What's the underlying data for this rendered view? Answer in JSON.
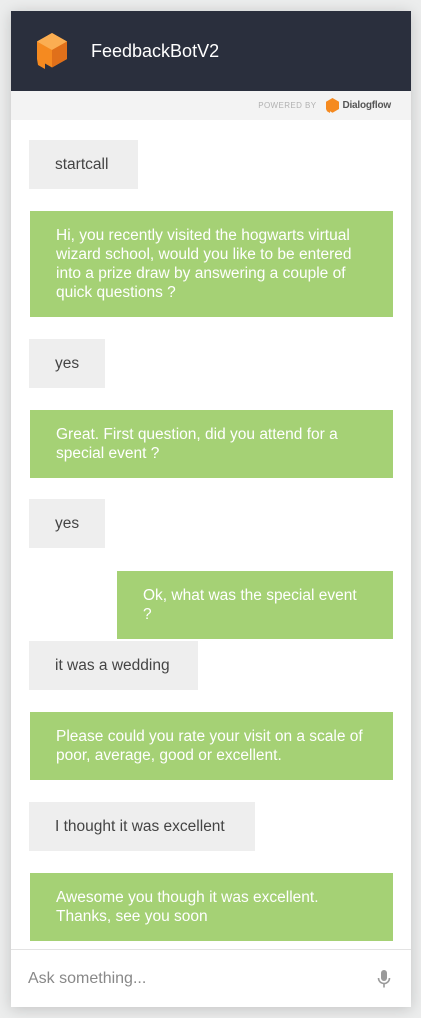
{
  "header": {
    "title": "FeedbackBotV2",
    "logo_icon": "dialogflow-bot-icon"
  },
  "powered_by": {
    "label": "POWERED BY",
    "brand": "Dialogflow"
  },
  "messages": [
    {
      "from": "user",
      "text": "startcall"
    },
    {
      "from": "bot",
      "text": "Hi, you recently visited the hogwarts virtual wizard school, would you like to be entered into a prize draw by answering a couple of quick questions ?"
    },
    {
      "from": "user",
      "text": "yes"
    },
    {
      "from": "bot",
      "text": "Great. First question, did you attend for a special event ?"
    },
    {
      "from": "user",
      "text": "yes"
    },
    {
      "from": "bot",
      "text": "Ok, what was the special event ?"
    },
    {
      "from": "user",
      "text": "it was a wedding"
    },
    {
      "from": "bot",
      "text": "Please could you rate your visit on a scale of poor, average, good or excellent."
    },
    {
      "from": "user",
      "text": "I thought it was excellent"
    },
    {
      "from": "bot",
      "text": "Awesome you though it was excellent. Thanks, see you soon"
    }
  ],
  "input": {
    "placeholder": "Ask something...",
    "value": "",
    "mic_icon": "microphone-icon"
  },
  "colors": {
    "header_bg": "#2a2f3d",
    "bot_bubble": "#a5d175",
    "user_bubble": "#eeeeee",
    "logo_orange": "#f58a20"
  }
}
